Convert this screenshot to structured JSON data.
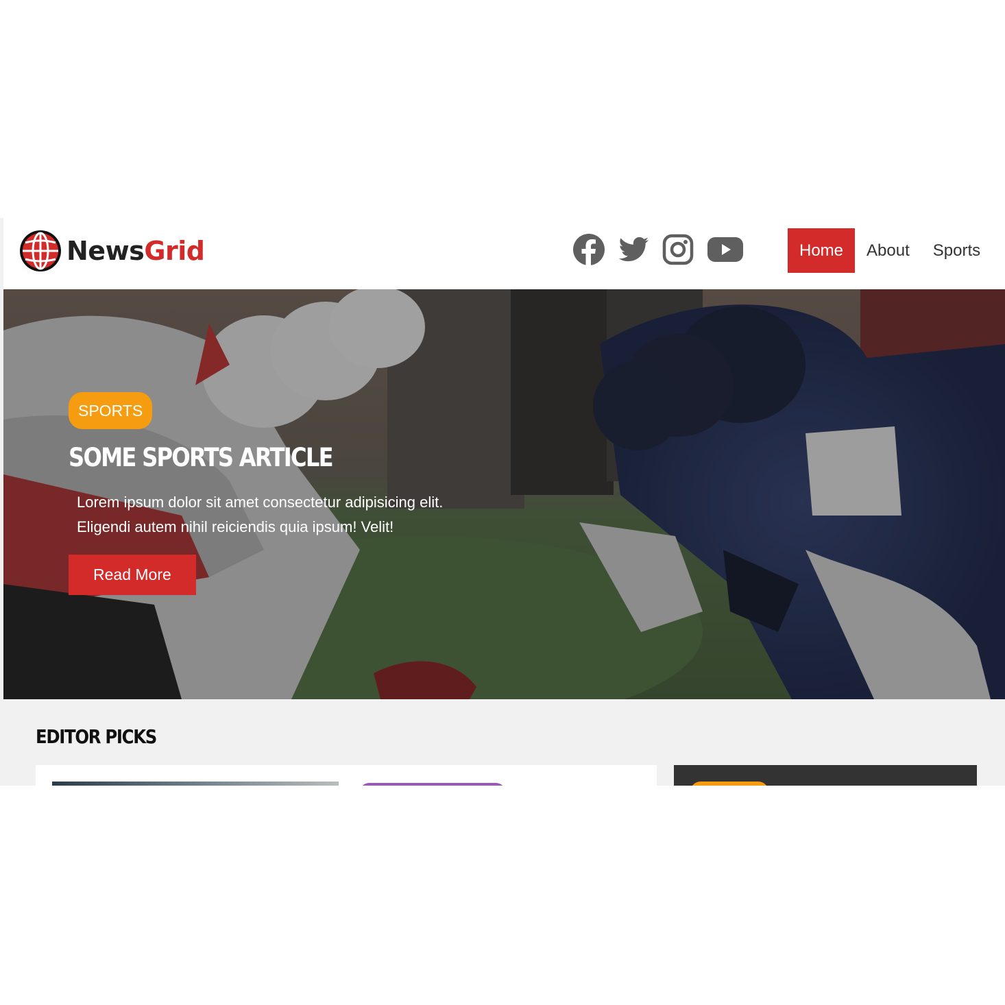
{
  "brand": {
    "name_part1": "News",
    "name_part2": "Grid",
    "accent_color": "#d32a2a"
  },
  "social": [
    {
      "icon": "facebook-icon"
    },
    {
      "icon": "twitter-icon"
    },
    {
      "icon": "instagram-icon"
    },
    {
      "icon": "youtube-icon"
    }
  ],
  "nav": {
    "home": "Home",
    "about": "About",
    "sports": "Sports",
    "active": "Home"
  },
  "hero": {
    "badge": "SPORTS",
    "badge_color": "#f59c10",
    "title": "Some Sports Article",
    "description": "Lorem ipsum dolor sit amet consectetur adipisicing elit. Eligendi autem nihil reiciendis quia ipsum! Velit!",
    "button": "Read More"
  },
  "editor_picks": {
    "title": "Editor Picks",
    "pill_colors": [
      "#9a59b5",
      "#f59c10"
    ]
  }
}
